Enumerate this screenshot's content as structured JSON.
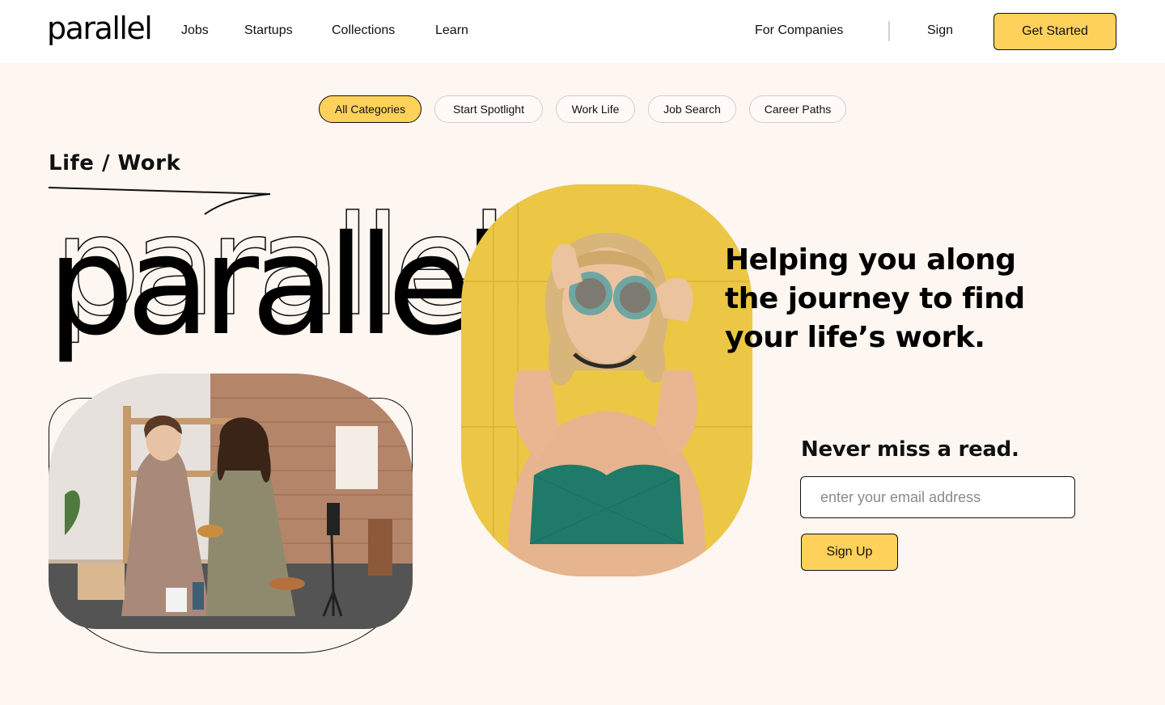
{
  "header": {
    "logo": "parallel",
    "nav": [
      "Jobs",
      "Startups",
      "Collections",
      "Learn"
    ],
    "for_companies": "For Companies",
    "sign": "Sign",
    "cta": "Get Started"
  },
  "categories": {
    "items": [
      "All Categories",
      "Start Spotlight",
      "Work Life",
      "Job Search",
      "Career Paths"
    ],
    "active": "All Categories"
  },
  "hero": {
    "section_label": "Life / Work",
    "big_word": "parallel",
    "tagline_lines": [
      "Helping you along",
      "the journey to find",
      "your life’s work."
    ]
  },
  "newsletter": {
    "title": "Never miss a read.",
    "email_placeholder": "enter your email address",
    "email_value": "",
    "submit": "Sign Up"
  },
  "colors": {
    "accent": "#fed15a",
    "page_bg": "#fdf6f1",
    "header_bg": "#ffffff",
    "text": "#111111"
  }
}
